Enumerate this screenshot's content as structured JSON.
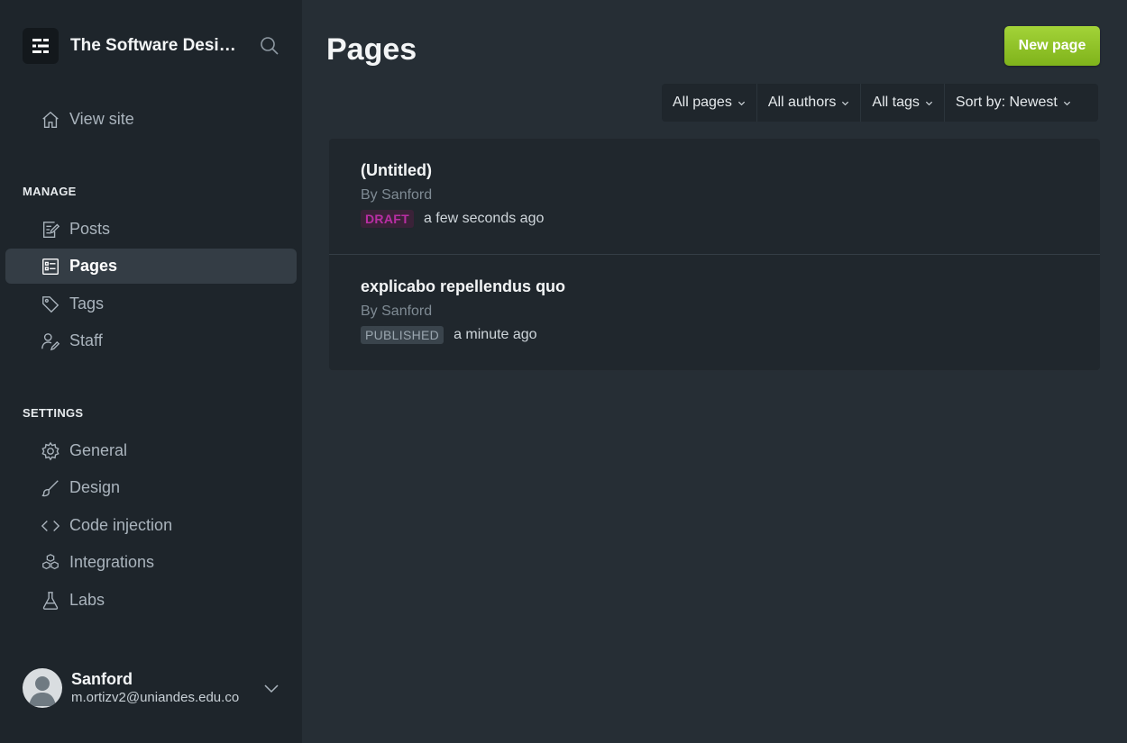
{
  "sidebar": {
    "brand": "The Software Design",
    "view_site": "View site",
    "manage_label": "MANAGE",
    "manage_items": [
      "Posts",
      "Pages",
      "Tags",
      "Staff"
    ],
    "settings_label": "SETTINGS",
    "settings_items": [
      "General",
      "Design",
      "Code injection",
      "Integrations",
      "Labs"
    ],
    "active_item": "Pages"
  },
  "user": {
    "name": "Sanford",
    "email": "m.ortizv2@uniandes.edu.co"
  },
  "main": {
    "title": "Pages",
    "new_button": "New page",
    "filters": [
      "All pages",
      "All authors",
      "All tags",
      "Sort by: Newest"
    ],
    "rows": [
      {
        "title": "(Untitled)",
        "author": "By Sanford",
        "status": "DRAFT",
        "time": "a few seconds ago"
      },
      {
        "title": "explicabo repellendus quo",
        "author": "By Sanford",
        "status": "PUBLISHED",
        "time": "a minute ago"
      }
    ]
  },
  "colors": {
    "accent": "#9bcb30",
    "draft": "#b92ea4",
    "sidebar_bg": "#1e252b",
    "main_bg": "#262e35"
  }
}
